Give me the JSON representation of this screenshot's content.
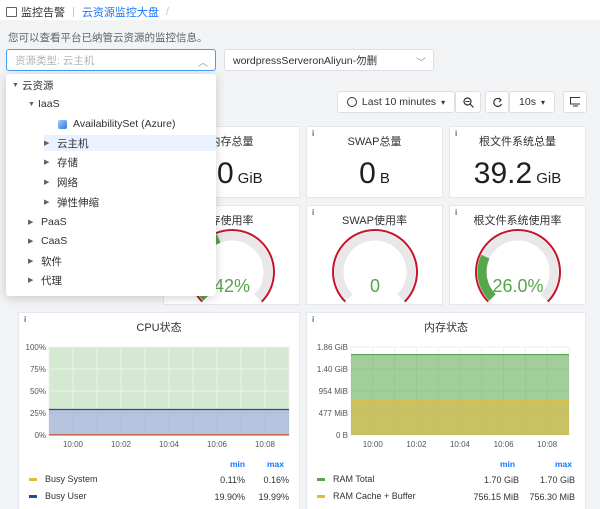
{
  "breadcrumb": {
    "root": "监控告警",
    "current": "云资源监控大盘",
    "trailing_sep": "/"
  },
  "hint": "您可以查看平台已纳管云资源的监控信息。",
  "filters": {
    "resource_type_placeholder": "资源类型: 云主机",
    "instance_value": "wordpressServeronAliyun-勿删"
  },
  "toolbar": {
    "time_range": "Last 10 minutes",
    "refresh_interval": "10s"
  },
  "tree": {
    "root": "云资源",
    "iaas": "IaaS",
    "availabilityset": "AvailabilitySet (Azure)",
    "vm": "云主机",
    "storage": "存储",
    "network": "网络",
    "autoscaling": "弹性伸缩",
    "paas": "PaaS",
    "caas": "CaaS",
    "software": "软件",
    "proxy": "代理"
  },
  "stats": {
    "memory_total": {
      "title": "内存总量",
      "value": "70",
      "unit": "GiB"
    },
    "swap_total": {
      "title": "SWAP总量",
      "value": "0",
      "unit": "B"
    },
    "rootfs_total": {
      "title": "根文件系统总量",
      "value": "39.2",
      "unit": "GiB"
    }
  },
  "gauges": {
    "memory_usage": {
      "title": "存使用率",
      "value_text": "42%",
      "value": 42,
      "color": "#56a64b"
    },
    "swap_usage": {
      "title": "SWAP使用率",
      "value_text": "0",
      "value": 0,
      "color": "#56a64b"
    },
    "rootfs_usage": {
      "title": "根文件系统使用率",
      "value_text": "26.0%",
      "value": 26,
      "color": "#56a64b"
    }
  },
  "cpu_panel": {
    "title": "CPU状态",
    "legend_headers": {
      "min": "min",
      "max": "max"
    },
    "legend": [
      {
        "name": "Busy System",
        "min": "0.11%",
        "max": "0.16%",
        "color": "#eab839"
      },
      {
        "name": "Busy User",
        "min": "19.90%",
        "max": "19.99%",
        "color": "#1f4e9c"
      }
    ]
  },
  "mem_panel": {
    "title": "内存状态",
    "legend_headers": {
      "min": "min",
      "max": "max"
    },
    "legend": [
      {
        "name": "RAM Total",
        "min": "1.70 GiB",
        "max": "1.70 GiB",
        "color": "#56a64b"
      },
      {
        "name": "RAM Cache + Buffer",
        "min": "756.15 MiB",
        "max": "756.30 MiB",
        "color": "#eab839"
      }
    ]
  },
  "chart_data": [
    {
      "type": "area",
      "title": "CPU状态",
      "x": [
        "10:00",
        "10:02",
        "10:04",
        "10:06",
        "10:08"
      ],
      "y_ticks": [
        "0%",
        "25%",
        "50%",
        "75%",
        "100%"
      ],
      "ylim": [
        0,
        100
      ],
      "series": [
        {
          "name": "Busy System",
          "values": [
            0.13,
            0.13,
            0.13,
            0.13,
            0.13
          ]
        },
        {
          "name": "Busy User",
          "values": [
            29,
            29,
            29,
            29,
            29
          ]
        }
      ]
    },
    {
      "type": "area",
      "title": "内存状态",
      "x": [
        "10:00",
        "10:02",
        "10:04",
        "10:06",
        "10:08"
      ],
      "y_ticks": [
        "0 B",
        "477 MiB",
        "954 MiB",
        "1.40 GiB",
        "1.86 GiB"
      ],
      "ylim": [
        0,
        1.86
      ],
      "series": [
        {
          "name": "RAM Total",
          "values": [
            1.7,
            1.7,
            1.7,
            1.7,
            1.7
          ]
        },
        {
          "name": "RAM Cache + Buffer",
          "values": [
            0.74,
            0.74,
            0.74,
            0.74,
            0.74
          ]
        }
      ]
    }
  ]
}
